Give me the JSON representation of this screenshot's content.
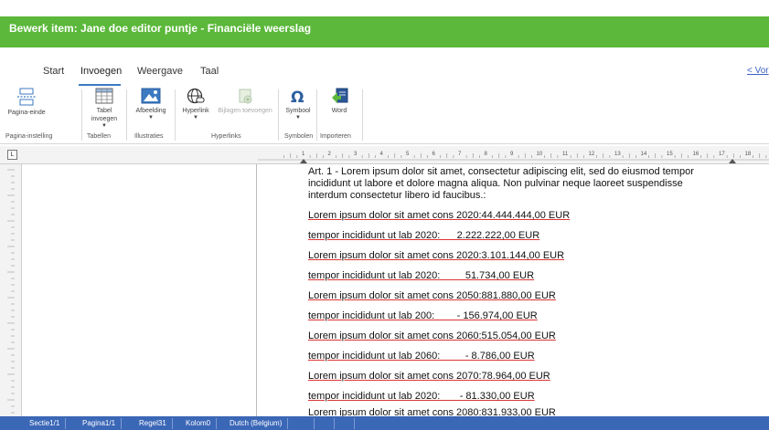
{
  "window": {
    "title": "Bewerk item: Jane doe editor puntje - Financiële weerslag",
    "back_link": "< Vor"
  },
  "ribbon": {
    "tabs": [
      {
        "label": "Start",
        "active": false
      },
      {
        "label": "Invoegen",
        "active": true
      },
      {
        "label": "Weergave",
        "active": false
      },
      {
        "label": "Taal",
        "active": false
      }
    ],
    "buttons": {
      "pagina_einde": "Pagina-einde",
      "tabel": "Tabel invoegen",
      "afbeelding": "Afbeelding",
      "hyperlink": "Hyperlink",
      "bijlagen": "Bijlagen toevoegen",
      "symbool": "Symbool",
      "word": "Word"
    },
    "groups": {
      "pagina_instelling": "Pagina-instelling",
      "tabellen": "Tabellen",
      "illustraties": "Illustraties",
      "hyperlinks": "Hyperlinks",
      "symbolen": "Symbolen",
      "importeren": "Importeren"
    }
  },
  "ruler": {
    "corner": "L",
    "numbers": [
      "1",
      "2",
      "3",
      "4",
      "5",
      "6",
      "7",
      "8",
      "9",
      "10",
      "11",
      "12",
      "13",
      "14",
      "15",
      "16",
      "17",
      "18"
    ]
  },
  "document": {
    "intro": "Art. 1 - Lorem ipsum dolor sit amet, consectetur adipiscing elit, sed do eiusmod tempor incididunt ut labore et dolore magna aliqua. Non pulvinar neque laoreet suspendisse interdum consectetur libero id faucibus.:",
    "lines": [
      "Lorem ipsum dolor sit amet cons 2020:44.444.444,00 EUR",
      "tempor incididunt ut lab 2020:      2.222.222,00 EUR",
      "Lorem ipsum dolor sit amet cons 2020:3.101.144,00 EUR",
      "tempor incididunt ut lab 2020:         51.734,00 EUR",
      "Lorem ipsum dolor sit amet cons 2050:881.880,00 EUR",
      "tempor incididunt ut lab 200:        - 156.974,00 EUR",
      "Lorem ipsum dolor sit amet cons 2060:515.054,00 EUR",
      "tempor incididunt ut lab 2060:         - 8.786,00 EUR",
      "Lorem ipsum dolor sit amet cons 2070:78.964,00 EUR",
      "tempor incididunt ut lab 2020:       - 81.330,00 EUR",
      "Lorem ipsum dolor sit amet cons 2080:831.933,00 EUR"
    ]
  },
  "statusbar": {
    "sectie": "Sectie1/1",
    "pagina": "Pagina1/1",
    "regel": "Regel31",
    "kolom": "Kolom0",
    "taal": "Dutch (Belgium)"
  },
  "colors": {
    "title_bar": "#5bb83a",
    "status_bar": "#3b67b7",
    "accent": "#3c7ac2"
  }
}
